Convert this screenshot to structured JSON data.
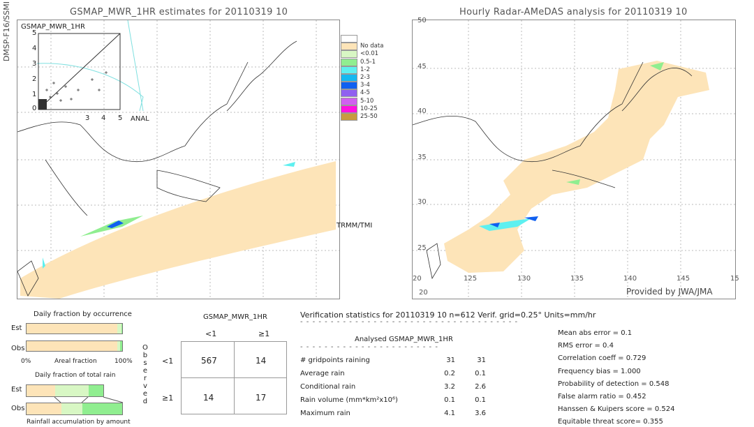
{
  "left_map": {
    "side_label": "DMSP-F16/SSMI",
    "title": "GSMAP_MWR_1HR estimates for 20110319 10",
    "swath_label": "TRMM/TMI",
    "inset": {
      "title": "GSMAP_MWR_1HR",
      "xlabel": "ANAL",
      "ticks": [
        "0",
        "1",
        "2",
        "3",
        "4",
        "5"
      ]
    }
  },
  "legend": {
    "items": [
      {
        "label": "",
        "color": "#ffffff"
      },
      {
        "label": "No data",
        "color": "#fde4b8"
      },
      {
        "label": "<0.01",
        "color": "#d8f7c4"
      },
      {
        "label": "0.5-1",
        "color": "#90ee90"
      },
      {
        "label": "1-2",
        "color": "#5ef0f0"
      },
      {
        "label": "2-3",
        "color": "#16b8f0"
      },
      {
        "label": "3-4",
        "color": "#1060f0"
      },
      {
        "label": "4-5",
        "color": "#9060f0"
      },
      {
        "label": "5-10",
        "color": "#d060f0"
      },
      {
        "label": "10-25",
        "color": "#ff10e0"
      },
      {
        "label": "25-50",
        "color": "#c89a40"
      }
    ]
  },
  "right_map": {
    "title": "Hourly Radar-AMeDAS analysis for 20110319 10",
    "credit": "Provided by JWA/JMA",
    "lat_labels": [
      "50",
      "45",
      "40",
      "35",
      "30",
      "25",
      "20"
    ],
    "lon_labels": [
      "20",
      "125",
      "130",
      "135",
      "140",
      "145",
      "15"
    ],
    "bottom_lat": "20"
  },
  "occurrence": {
    "title": "Daily fraction by occurrence",
    "est_label": "Est",
    "obs_label": "Obs",
    "axis_left": "0%",
    "axis_mid": "Areal fraction",
    "axis_right": "100%",
    "est_fractions": [
      0.95,
      0.04,
      0.01
    ],
    "obs_fractions": [
      0.95,
      0.03,
      0.02
    ]
  },
  "total_rain": {
    "title": "Daily fraction of total rain",
    "est_label": "Est",
    "obs_label": "Obs",
    "footer": "Rainfall accumulation by amount"
  },
  "contingency": {
    "title": "GSMAP_MWR_1HR",
    "col_lt": "<1",
    "col_ge": "≥1",
    "row_lt": "<1",
    "row_ge": "≥1",
    "observed": [
      "O",
      "b",
      "s",
      "e",
      "r",
      "v",
      "e",
      "d"
    ],
    "cells": [
      [
        "567",
        "14"
      ],
      [
        "14",
        "17"
      ]
    ]
  },
  "stats": {
    "header": "Verification statistics for 20110319 10  n=612  Verif. grid=0.25°  Units=mm/hr",
    "col1": "Analysed",
    "col2": "GSMAP_MWR_1HR",
    "rows": [
      {
        "label": "# gridpoints raining",
        "a": "31",
        "b": "31"
      },
      {
        "label": "Average rain",
        "a": "0.2",
        "b": "0.1"
      },
      {
        "label": "Conditional rain",
        "a": "3.2",
        "b": "2.6"
      },
      {
        "label": "Rain volume (mm*km²x10⁶)",
        "a": "0.1",
        "b": "0.1"
      },
      {
        "label": "Maximum rain",
        "a": "4.1",
        "b": "3.6"
      }
    ],
    "scores": [
      "Mean abs error = 0.1",
      "RMS error = 0.4",
      "Correlation coeff = 0.729",
      "Frequency bias = 1.000",
      "Probability of detection = 0.548",
      "False alarm ratio = 0.452",
      "Hanssen & Kuipers score = 0.524",
      "Equitable threat score= 0.355"
    ]
  }
}
